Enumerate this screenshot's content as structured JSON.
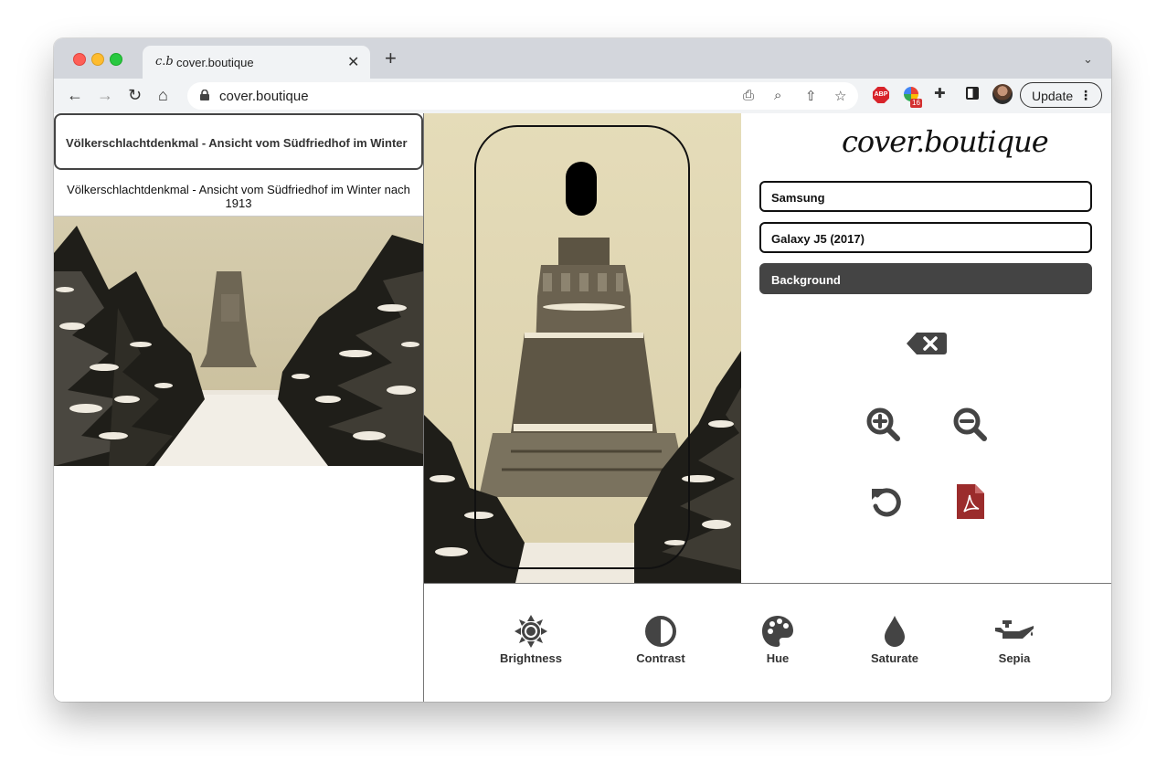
{
  "browser": {
    "tab": {
      "favicon": "c.b",
      "title": "cover.boutique"
    },
    "url": "cover.boutique",
    "extension_badge": "16",
    "abp_label": "ABP",
    "update_label": "Update"
  },
  "left_panel": {
    "search_value": "Völkerschlachtdenkmal - Ansicht vom Südfriedhof im Winter",
    "result_title": "Völkerschlachtdenkmal - Ansicht vom Südfriedhof im Winter nach 1913"
  },
  "right_panel": {
    "logo": "cover.boutique",
    "brand_value": "Samsung",
    "model_value": "Galaxy J5 (2017)",
    "background_label": "Background"
  },
  "filters": [
    {
      "label": "Brightness",
      "icon": "sun-icon"
    },
    {
      "label": "Contrast",
      "icon": "contrast-icon"
    },
    {
      "label": "Hue",
      "icon": "palette-icon"
    },
    {
      "label": "Saturate",
      "icon": "droplet-icon"
    },
    {
      "label": "Sepia",
      "icon": "oil-can-icon"
    }
  ],
  "tools": [
    "delete-icon",
    "zoom-in-icon",
    "zoom-out-icon",
    "undo-icon",
    "pdf-icon"
  ],
  "colors": {
    "dark": "#444444",
    "pdf_red": "#9b2c2c",
    "photo_sepia": "#e8dfbe"
  }
}
